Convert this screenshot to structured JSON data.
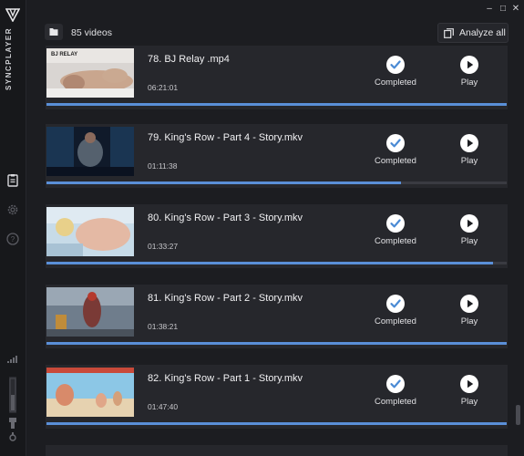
{
  "app": {
    "brand": "SYNCPLAYER"
  },
  "header": {
    "video_count": "85 videos",
    "analyze_label": "Analyze all"
  },
  "videos": [
    {
      "title": "78. BJ Relay .mp4",
      "duration": "06:21:01",
      "status": "Completed",
      "play": "Play",
      "progress": 1.0,
      "thumb_text": "BJ RELAY"
    },
    {
      "title": "79. King's Row - Part 4 - Story.mkv",
      "duration": "01:11:38",
      "status": "Completed",
      "play": "Play",
      "progress": 0.77
    },
    {
      "title": "80. King's Row - Part 3 - Story.mkv",
      "duration": "01:33:27",
      "status": "Completed",
      "play": "Play",
      "progress": 0.97
    },
    {
      "title": "81. King's Row - Part 2 - Story.mkv",
      "duration": "01:38:21",
      "status": "Completed",
      "play": "Play",
      "progress": 1.0
    },
    {
      "title": "82. King's Row - Part 1 - Story.mkv",
      "duration": "01:47:40",
      "status": "Completed",
      "play": "Play",
      "progress": 1.0
    }
  ],
  "colors": {
    "accent": "#5a8fd8",
    "check": "#4a8ad4"
  }
}
